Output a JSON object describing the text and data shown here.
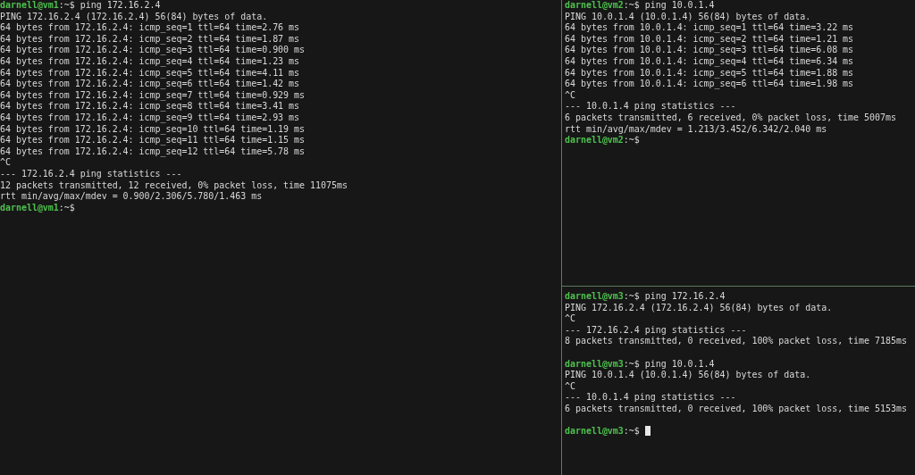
{
  "panes": [
    {
      "lines": [
        {
          "kind": "prompt",
          "user": "darnell@vm1",
          "rest": ":~$ ping 172.16.2.4"
        },
        {
          "kind": "output",
          "text": "PING 172.16.2.4 (172.16.2.4) 56(84) bytes of data."
        },
        {
          "kind": "output",
          "text": "64 bytes from 172.16.2.4: icmp_seq=1 ttl=64 time=2.76 ms"
        },
        {
          "kind": "output",
          "text": "64 bytes from 172.16.2.4: icmp_seq=2 ttl=64 time=1.87 ms"
        },
        {
          "kind": "output",
          "text": "64 bytes from 172.16.2.4: icmp_seq=3 ttl=64 time=0.900 ms"
        },
        {
          "kind": "output",
          "text": "64 bytes from 172.16.2.4: icmp_seq=4 ttl=64 time=1.23 ms"
        },
        {
          "kind": "output",
          "text": "64 bytes from 172.16.2.4: icmp_seq=5 ttl=64 time=4.11 ms"
        },
        {
          "kind": "output",
          "text": "64 bytes from 172.16.2.4: icmp_seq=6 ttl=64 time=1.42 ms"
        },
        {
          "kind": "output",
          "text": "64 bytes from 172.16.2.4: icmp_seq=7 ttl=64 time=0.929 ms"
        },
        {
          "kind": "output",
          "text": "64 bytes from 172.16.2.4: icmp_seq=8 ttl=64 time=3.41 ms"
        },
        {
          "kind": "output",
          "text": "64 bytes from 172.16.2.4: icmp_seq=9 ttl=64 time=2.93 ms"
        },
        {
          "kind": "output",
          "text": "64 bytes from 172.16.2.4: icmp_seq=10 ttl=64 time=1.19 ms"
        },
        {
          "kind": "output",
          "text": "64 bytes from 172.16.2.4: icmp_seq=11 ttl=64 time=1.15 ms"
        },
        {
          "kind": "output",
          "text": "64 bytes from 172.16.2.4: icmp_seq=12 ttl=64 time=5.78 ms"
        },
        {
          "kind": "output",
          "text": "^C"
        },
        {
          "kind": "output",
          "text": "--- 172.16.2.4 ping statistics ---"
        },
        {
          "kind": "output",
          "text": "12 packets transmitted, 12 received, 0% packet loss, time 11075ms"
        },
        {
          "kind": "output",
          "text": "rtt min/avg/max/mdev = 0.900/2.306/5.780/1.463 ms"
        },
        {
          "kind": "prompt",
          "user": "darnell@vm1",
          "rest": ":~$"
        }
      ]
    },
    {
      "lines": [
        {
          "kind": "prompt",
          "user": "darnell@vm2",
          "rest": ":~$ ping 10.0.1.4"
        },
        {
          "kind": "output",
          "text": "PING 10.0.1.4 (10.0.1.4) 56(84) bytes of data."
        },
        {
          "kind": "output",
          "text": "64 bytes from 10.0.1.4: icmp_seq=1 ttl=64 time=3.22 ms"
        },
        {
          "kind": "output",
          "text": "64 bytes from 10.0.1.4: icmp_seq=2 ttl=64 time=1.21 ms"
        },
        {
          "kind": "output",
          "text": "64 bytes from 10.0.1.4: icmp_seq=3 ttl=64 time=6.08 ms"
        },
        {
          "kind": "output",
          "text": "64 bytes from 10.0.1.4: icmp_seq=4 ttl=64 time=6.34 ms"
        },
        {
          "kind": "output",
          "text": "64 bytes from 10.0.1.4: icmp_seq=5 ttl=64 time=1.88 ms"
        },
        {
          "kind": "output",
          "text": "64 bytes from 10.0.1.4: icmp_seq=6 ttl=64 time=1.98 ms"
        },
        {
          "kind": "output",
          "text": "^C"
        },
        {
          "kind": "output",
          "text": "--- 10.0.1.4 ping statistics ---"
        },
        {
          "kind": "output",
          "text": "6 packets transmitted, 6 received, 0% packet loss, time 5007ms"
        },
        {
          "kind": "output",
          "text": "rtt min/avg/max/mdev = 1.213/3.452/6.342/2.040 ms"
        },
        {
          "kind": "prompt",
          "user": "darnell@vm2",
          "rest": ":~$"
        }
      ]
    },
    {
      "lines": [
        {
          "kind": "prompt",
          "user": "darnell@vm3",
          "rest": ":~$ ping 172.16.2.4"
        },
        {
          "kind": "output",
          "text": "PING 172.16.2.4 (172.16.2.4) 56(84) bytes of data."
        },
        {
          "kind": "output",
          "text": "^C"
        },
        {
          "kind": "output",
          "text": "--- 172.16.2.4 ping statistics ---"
        },
        {
          "kind": "output",
          "text": "8 packets transmitted, 0 received, 100% packet loss, time 7185ms"
        },
        {
          "kind": "blank"
        },
        {
          "kind": "prompt",
          "user": "darnell@vm3",
          "rest": ":~$ ping 10.0.1.4"
        },
        {
          "kind": "output",
          "text": "PING 10.0.1.4 (10.0.1.4) 56(84) bytes of data."
        },
        {
          "kind": "output",
          "text": "^C"
        },
        {
          "kind": "output",
          "text": "--- 10.0.1.4 ping statistics ---"
        },
        {
          "kind": "output",
          "text": "6 packets transmitted, 0 received, 100% packet loss, time 5153ms"
        },
        {
          "kind": "blank"
        },
        {
          "kind": "prompt",
          "user": "darnell@vm3",
          "rest": ":~$",
          "cursor": true
        }
      ]
    }
  ]
}
